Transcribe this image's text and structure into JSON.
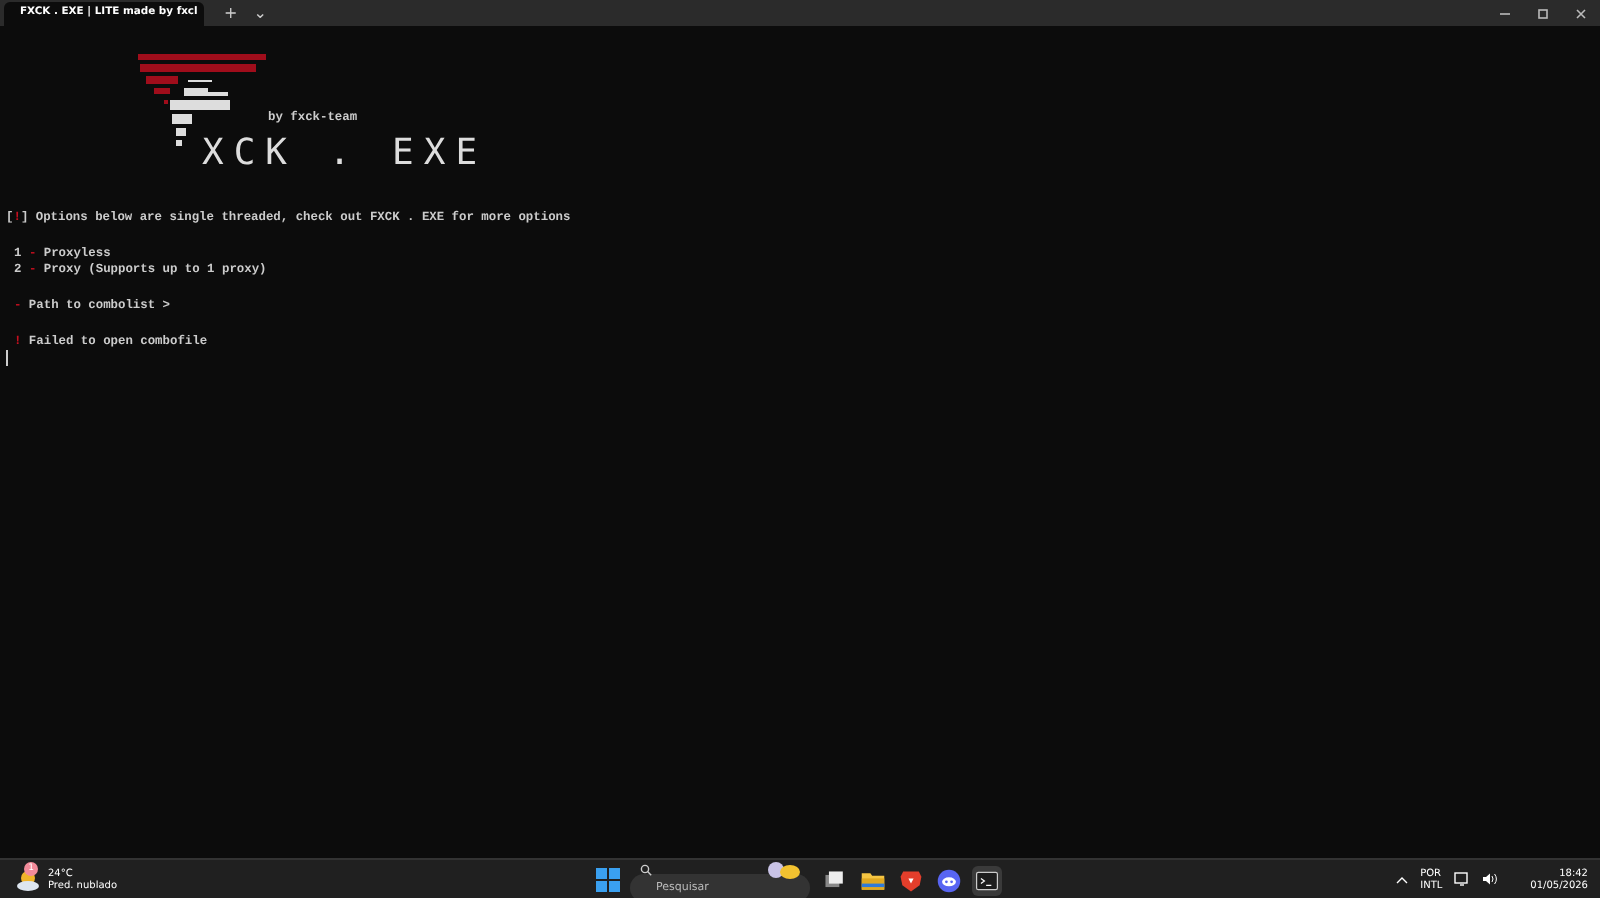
{
  "window": {
    "tab_title": "FXCK . EXE | LITE made by fxcl",
    "new_tab": "+",
    "dropdown": "⌄"
  },
  "banner": {
    "byline": "by fxck-team",
    "logo_text": "XCK . EXE"
  },
  "terminal_blocks": [
    [
      {
        "indented": false,
        "segments": [
          {
            "text": "[",
            "accent": false
          },
          {
            "text": "!",
            "accent": true
          },
          {
            "text": "] Options below are single threaded, check out FXCK . EXE for more options",
            "accent": false
          }
        ]
      }
    ],
    [
      {
        "indented": true,
        "segments": [
          {
            "text": "1 ",
            "accent": false
          },
          {
            "text": "-",
            "accent": true
          },
          {
            "text": " Proxyless",
            "accent": false
          }
        ]
      },
      {
        "indented": true,
        "segments": [
          {
            "text": "2 ",
            "accent": false
          },
          {
            "text": "-",
            "accent": true
          },
          {
            "text": " Proxy (Supports up to 1 proxy)",
            "accent": false
          }
        ]
      }
    ],
    [
      {
        "indented": true,
        "segments": [
          {
            "text": "-",
            "accent": true
          },
          {
            "text": " Path to combolist >",
            "accent": false
          }
        ]
      }
    ],
    [
      {
        "indented": true,
        "segments": [
          {
            "text": "!",
            "accent": true
          },
          {
            "text": " Failed to open combofile",
            "accent": false
          }
        ]
      }
    ]
  ],
  "taskbar": {
    "weather_temp": "24°C",
    "weather_desc": "Pred. nublado",
    "weather_badge": "1",
    "search_placeholder": "Pesquisar",
    "lang_top": "POR",
    "lang_bottom": "INTL",
    "time": "18:42",
    "date": "01/05/2026",
    "apps": [
      {
        "kind": "taskview",
        "active": false
      },
      {
        "kind": "folder",
        "active": false
      },
      {
        "kind": "brave",
        "active": false
      },
      {
        "kind": "discord",
        "active": false
      },
      {
        "kind": "terminal",
        "active": true
      }
    ]
  }
}
